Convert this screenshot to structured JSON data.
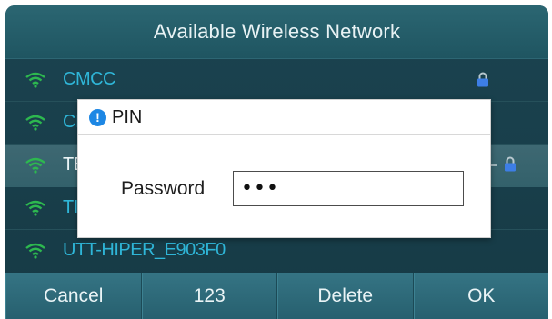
{
  "header": {
    "title": "Available Wireless Network"
  },
  "networks": [
    {
      "ssid": "CMCC",
      "secured": true,
      "selected": false
    },
    {
      "ssid": "CI",
      "secured": false,
      "selected": false
    },
    {
      "ssid": "TE",
      "secured": true,
      "selected": true
    },
    {
      "ssid": "TI",
      "secured": false,
      "selected": false
    },
    {
      "ssid": "UTT-HIPER_E903F0",
      "secured": false,
      "selected": false
    }
  ],
  "dialog": {
    "icon": "info-icon",
    "icon_glyph": "!",
    "title": "PIN",
    "password_label": "Password",
    "password_value": "•••"
  },
  "softkeys": [
    "Cancel",
    "123",
    "Delete",
    "OK"
  ],
  "colors": {
    "header": "#2b6672",
    "list_bg": "#1b4350",
    "ssid_text": "#2fb6d8",
    "softkey_bg": "#357484",
    "dialog_icon": "#1d87e4"
  }
}
